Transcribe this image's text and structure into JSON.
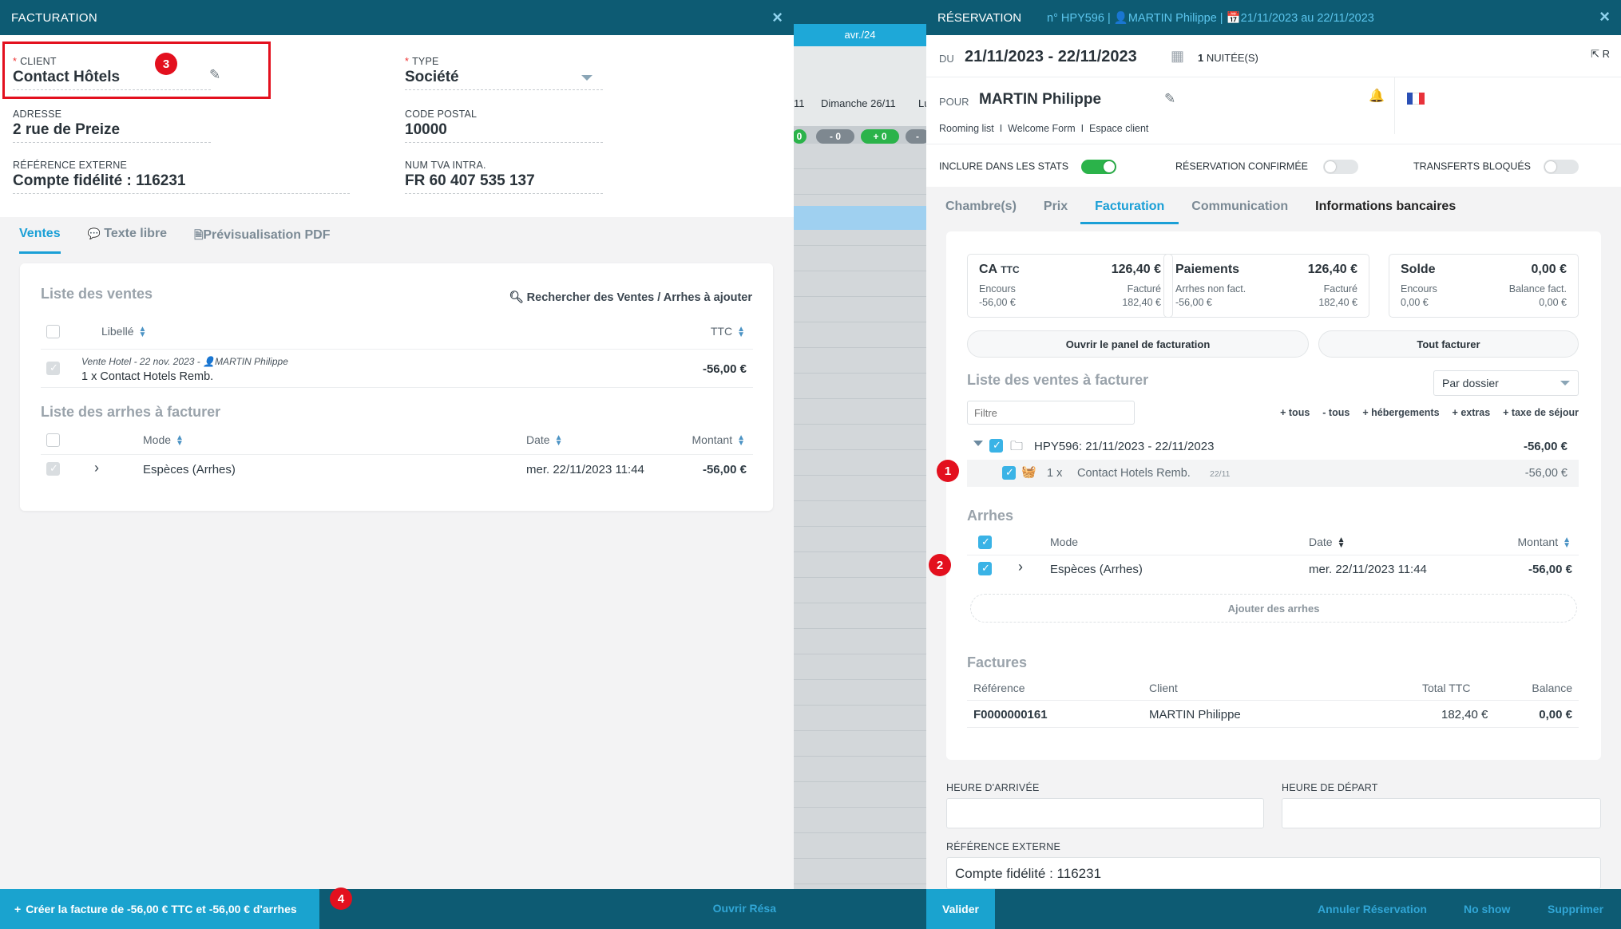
{
  "facturation": {
    "title": "FACTURATION",
    "close": "×",
    "client": {
      "label": "CLIENT",
      "value": "Contact Hôtels"
    },
    "type": {
      "label": "TYPE",
      "value": "Société"
    },
    "adresse": {
      "label": "ADRESSE",
      "value": "2 rue de Preize"
    },
    "code_postal": {
      "label": "CODE POSTAL",
      "value": "10000"
    },
    "reference_externe": {
      "label": "RÉFÉRENCE EXTERNE",
      "value": "Compte fidélité : 116231"
    },
    "num_tva": {
      "label": "NUM TVA INTRA.",
      "value": "FR 60 407 535 137"
    },
    "tabs": [
      "Ventes",
      "Texte libre",
      "Prévisualisation PDF"
    ],
    "ventes": {
      "title": "Liste des ventes",
      "search": "Rechercher des Ventes / Arrhes à ajouter",
      "col_libelle": "Libellé",
      "col_ttc": "TTC",
      "row": {
        "meta_prefix": "Vente Hotel - 22 nov. 2023 -",
        "meta_person": "MARTIN Philippe",
        "label": "1 x Contact Hotels Remb.",
        "amount": "-56,00 €"
      }
    },
    "arrhes": {
      "title": "Liste des arrhes à facturer",
      "col_mode": "Mode",
      "col_date": "Date",
      "col_montant": "Montant",
      "row": {
        "mode": "Espèces (Arrhes)",
        "date": "mer. 22/11/2023 11:44",
        "amount": "-56,00 €"
      }
    },
    "create_button": "Créer la facture de -56,00 € TTC et -56,00 € d'arrhes",
    "ouvrir_resa": "Ouvrir Résa",
    "annotations": [
      "3",
      "4"
    ]
  },
  "calendar": {
    "month": "avr./24",
    "day_left": "11",
    "day": "Dimanche 26/11",
    "day_right": "Lu",
    "pills": [
      "0",
      "- 0",
      "+ 0",
      "-"
    ]
  },
  "reservation": {
    "title": "RÉSERVATION",
    "number": "n° HPY596",
    "guest": "MARTIN Philippe",
    "dates": "21/11/2023 au 22/11/2023",
    "close": "×",
    "du_label": "DU",
    "du_value": "21/11/2023 - 22/11/2023",
    "nuitees": "1",
    "nuitees_label": "NUITÉE(S)",
    "open_label": "R",
    "pour_label": "POUR",
    "pour_value": "MARTIN Philippe",
    "links": [
      "Rooming list",
      "Welcome Form",
      "Espace client"
    ],
    "toggles": [
      {
        "label": "INCLURE DANS LES STATS",
        "on": true
      },
      {
        "label": "RÉSERVATION CONFIRMÉE",
        "on": false
      },
      {
        "label": "TRANSFERTS BLOQUÉS",
        "on": false
      }
    ],
    "tabs": [
      "Chambre(s)",
      "Prix",
      "Facturation",
      "Communication",
      "Informations bancaires"
    ],
    "kpis": [
      {
        "title": "CA",
        "title_suffix": "TTC",
        "value": "126,40 €",
        "sub1_l": "Encours",
        "sub1_r": "Facturé",
        "sub2_l": "-56,00 €",
        "sub2_r": "182,40 €"
      },
      {
        "title": "Paiements",
        "title_suffix": "",
        "value": "126,40 €",
        "sub1_l": "Arrhes non fact.",
        "sub1_r": "Facturé",
        "sub2_l": "-56,00 €",
        "sub2_r": "182,40 €"
      },
      {
        "title": "Solde",
        "title_suffix": "",
        "value": "0,00 €",
        "sub1_l": "Encours",
        "sub1_r": "Balance fact.",
        "sub2_l": "0,00 €",
        "sub2_r": "0,00 €"
      }
    ],
    "btn_panel": "Ouvrir le panel de facturation",
    "btn_tout": "Tout facturer",
    "ventes_title": "Liste des ventes à facturer",
    "par_dossier": "Par dossier",
    "filtre_placeholder": "Filtre",
    "filters": [
      "+ tous",
      "- tous",
      "+ hébergements",
      "+ extras",
      "+ taxe de séjour"
    ],
    "dossier": {
      "label": "HPY596: 21/11/2023 - 22/11/2023",
      "amount": "-56,00 €"
    },
    "item": {
      "qty": "1 x",
      "label": "Contact Hotels Remb.",
      "date": "22/11",
      "amount": "-56,00 €"
    },
    "arrhes_title": "Arrhes",
    "arrhes_cols": {
      "mode": "Mode",
      "date": "Date",
      "montant": "Montant"
    },
    "arrhes_row": {
      "mode": "Espèces (Arrhes)",
      "date": "mer. 22/11/2023 11:44",
      "amount": "-56,00 €"
    },
    "ajouter_arrhes": "Ajouter des arrhes",
    "factures_title": "Factures",
    "factures_cols": {
      "ref": "Référence",
      "client": "Client",
      "total": "Total TTC",
      "balance": "Balance"
    },
    "facture_row": {
      "ref": "F0000000161",
      "client": "MARTIN Philippe",
      "total": "182,40 €",
      "balance": "0,00 €"
    },
    "heure_arrivee": "HEURE D'ARRIVÉE",
    "heure_depart": "HEURE DE DÉPART",
    "ref_externe_label": "RÉFÉRENCE EXTERNE",
    "ref_externe_value": "Compte fidélité : 116231",
    "valider": "Valider",
    "annuler": "Annuler Réservation",
    "no_show": "No show",
    "supprimer": "Supprimer",
    "annotations": [
      "1",
      "2"
    ]
  },
  "colors": {
    "header": "#0d5b73",
    "accent": "#1a9fd6",
    "annotation": "#e3101e",
    "toggle_on": "#2bb34a"
  }
}
